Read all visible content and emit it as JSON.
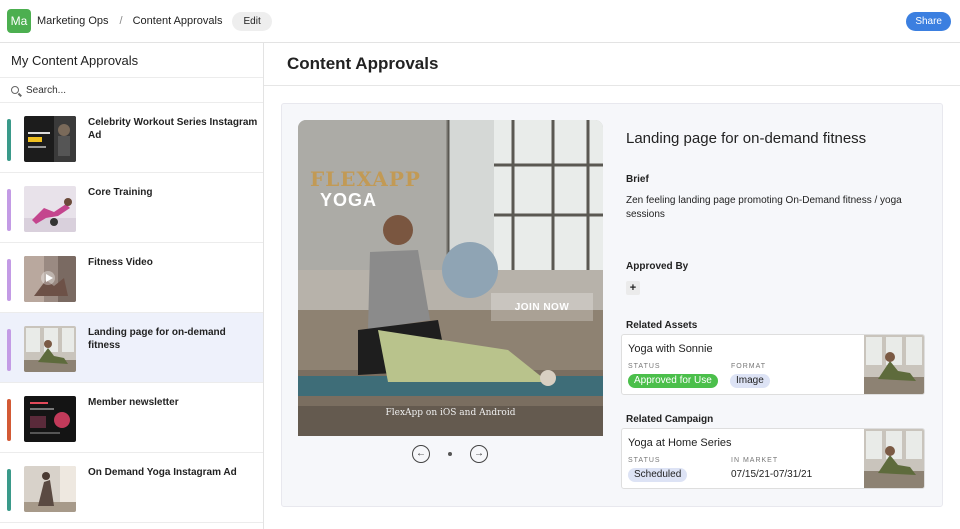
{
  "topbar": {
    "workspace_initials": "Ma",
    "workspace_name": "Marketing Ops",
    "separator": "/",
    "breadcrumb": "Content Approvals",
    "edit_label": "Edit",
    "share_label": "Share"
  },
  "sidebar": {
    "title": "My Content Approvals",
    "search_placeholder": "Search...",
    "items": [
      {
        "title": "Celebrity Workout Series Instagram Ad",
        "accent": "#3a9a8a"
      },
      {
        "title": "Core Training",
        "accent": "#c39be5"
      },
      {
        "title": "Fitness Video",
        "accent": "#c39be5"
      },
      {
        "title": "Landing page for on-demand fitness",
        "accent": "#c39be5"
      },
      {
        "title": "Member newsletter",
        "accent": "#d35a35"
      },
      {
        "title": "On Demand Yoga Instagram Ad",
        "accent": "#3a9a8a"
      }
    ]
  },
  "main": {
    "title": "Content Approvals",
    "hero": {
      "brand_a": "FLEXAPP",
      "brand_b": "YOGA",
      "cta": "JOIN NOW",
      "footer": "FlexApp on iOS and Android"
    },
    "carousel": {
      "prev": "←",
      "next": "→"
    },
    "detail": {
      "title": "Landing page for on-demand fitness",
      "brief_label": "Brief",
      "brief_text": "Zen feeling landing page promoting On-Demand fitness / yoga sessions",
      "approved_by_label": "Approved By",
      "add_label": "+",
      "related_assets_label": "Related Assets",
      "asset": {
        "name": "Yoga with Sonnie",
        "status_key": "STATUS",
        "status": "Approved for Use",
        "format_key": "FORMAT",
        "format": "Image"
      },
      "related_campaign_label": "Related Campaign",
      "campaign": {
        "name": "Yoga at Home Series",
        "status_key": "STATUS",
        "status": "Scheduled",
        "in_market_key": "IN MARKET",
        "in_market": "07/15/21-07/31/21"
      }
    }
  },
  "colors": {
    "share": "#3b7fe0",
    "approved_pill_bg": "#4bbf4b",
    "image_pill_bg": "#dde3f5",
    "scheduled_pill_bg": "#dde3f5",
    "active_row": "#eef1fb"
  }
}
